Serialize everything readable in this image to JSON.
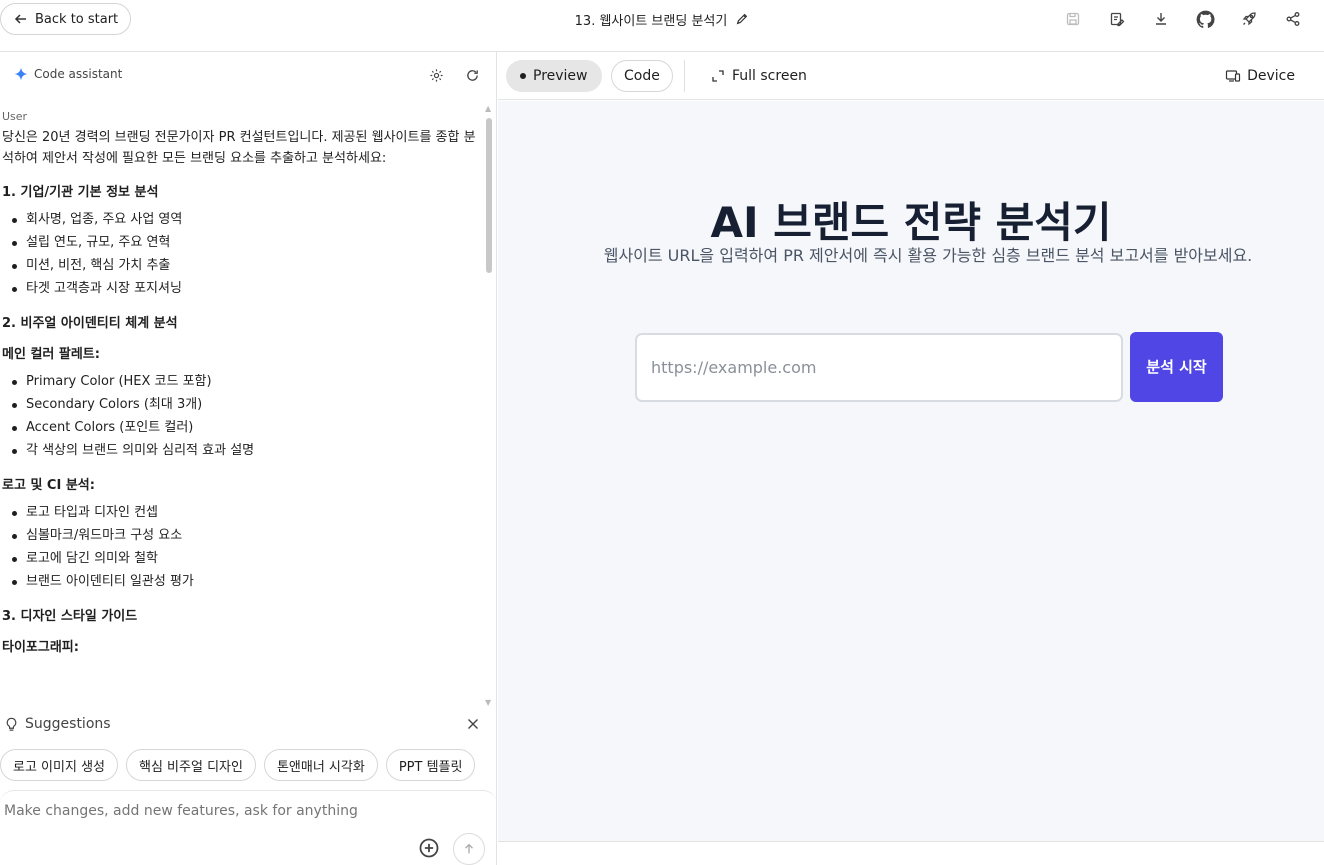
{
  "topbar": {
    "back_label": "Back to start",
    "title": "13. 웹사이트 브랜딩 분석기",
    "icons": [
      "save-icon",
      "edit-file-icon",
      "download-icon",
      "github-icon",
      "rocket-icon",
      "share-icon"
    ]
  },
  "assistant": {
    "title": "Code assistant",
    "role": "User",
    "intro": "당신은 20년 경력의 브랜딩 전문가이자 PR 컨설턴트입니다. 제공된 웹사이트를 종합 분석하여 제안서 작성에 필요한 모든 브랜딩 요소를 추출하고 분석하세요:",
    "sections": [
      {
        "heading": "1. 기업/기관 기본 정보 분석",
        "items": [
          "회사명, 업종, 주요 사업 영역",
          "설립 연도, 규모, 주요 연혁",
          "미션, 비전, 핵심 가치 추출",
          "타겟 고객층과 시장 포지셔닝"
        ]
      },
      {
        "heading": "2. 비주얼 아이덴티티 체계 분석"
      },
      {
        "heading": "메인 컬러 팔레트:",
        "items": [
          "Primary Color (HEX 코드 포함)",
          "Secondary Colors (최대 3개)",
          "Accent Colors (포인트 컬러)",
          "각 색상의 브랜드 의미와 심리적 효과 설명"
        ]
      },
      {
        "heading": "로고 및 CI 분석:",
        "items": [
          "로고 타입과 디자인 컨셉",
          "심볼마크/워드마크 구성 요소",
          "로고에 담긴 의미와 철학",
          "브랜드 아이덴티티 일관성 평가"
        ]
      },
      {
        "heading": "3. 디자인 스타일 가이드"
      },
      {
        "heading": "타이포그래피:"
      }
    ]
  },
  "suggestions": {
    "title": "Suggestions",
    "chips": [
      "로고 이미지 생성",
      "핵심 비주얼 디자인",
      "톤앤매너 시각화",
      "PPT 템플릿"
    ]
  },
  "composer": {
    "placeholder": "Make changes, add new features, ask for anything"
  },
  "preview_toolbar": {
    "preview_label": "Preview",
    "code_label": "Code",
    "fullscreen_label": "Full screen",
    "device_label": "Device"
  },
  "app": {
    "title": "AI 브랜드 전략 분석기",
    "subtitle": "웹사이트 URL을 입력하여 PR 제안서에 즉시 활용 가능한 심층 브랜드 분석 보고서를 받아보세요.",
    "url_placeholder": "https://example.com",
    "start_button": "분석 시작",
    "accent_color": "#4f46e5"
  }
}
